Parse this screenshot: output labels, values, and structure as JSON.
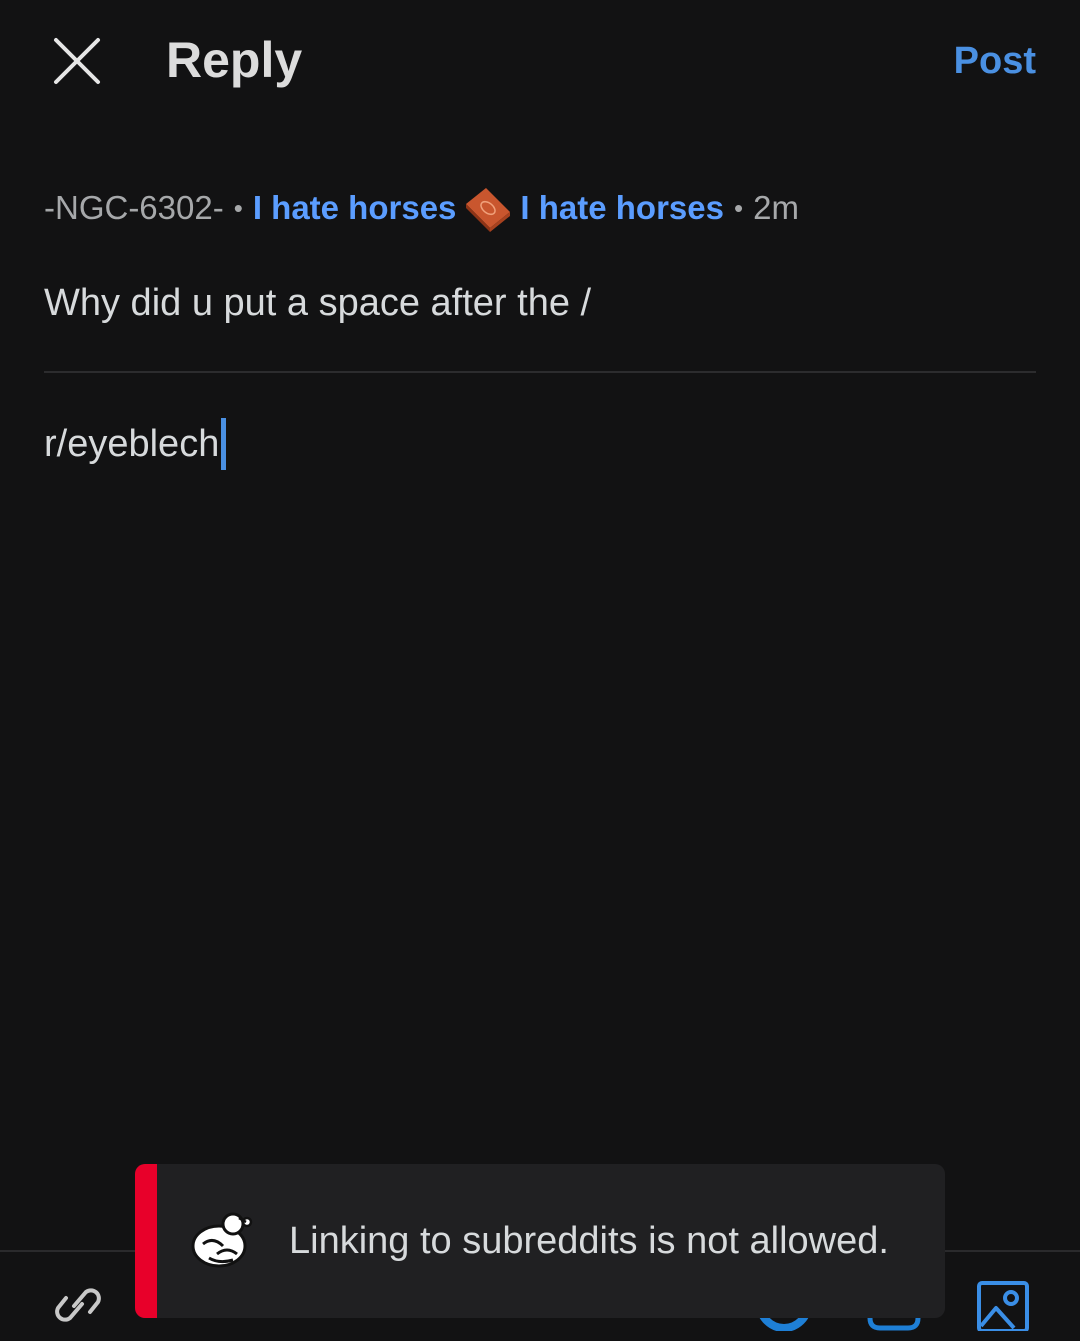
{
  "header": {
    "title": "Reply",
    "post_label": "Post"
  },
  "parent_comment": {
    "username": "-NGC-6302-",
    "separator": "•",
    "flair_left": "I hate horses",
    "flair_right": "I hate horses",
    "time": "2m",
    "body": "Why did u put a space after the /"
  },
  "editor": {
    "value": "r/eyeblech"
  },
  "toast": {
    "message": "Linking to subreddits is not allowed."
  },
  "colors": {
    "accent": "#4a90e2",
    "toast_bar": "#e8002a",
    "background": "#121213"
  }
}
